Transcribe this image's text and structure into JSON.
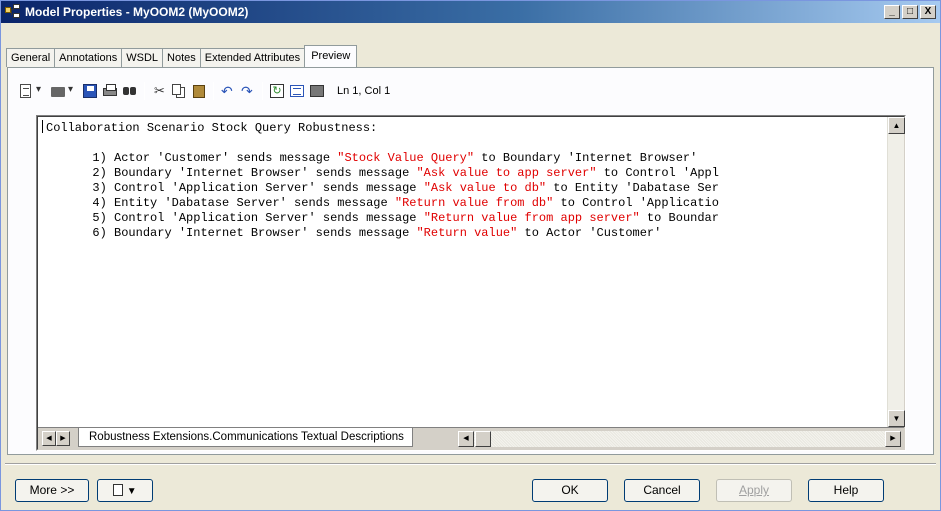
{
  "window": {
    "title": "Model Properties - MyOOM2 (MyOOM2)",
    "controls": {
      "minimize": "_",
      "maximize": "□",
      "close": "X"
    }
  },
  "tabs": [
    "General",
    "Annotations",
    "WSDL",
    "Notes",
    "Extended Attributes",
    "Preview"
  ],
  "active_tab": "Preview",
  "toolbar": {
    "icons": [
      "templates-dropdown-icon",
      "open-dropdown-icon",
      "save-icon",
      "print-icon",
      "find-icon",
      "cut-icon",
      "copy-icon",
      "paste-icon",
      "undo-icon",
      "redo-icon",
      "refresh-icon",
      "show-list-icon",
      "properties-icon"
    ],
    "cursor_position": "Ln 1, Col 1"
  },
  "editor": {
    "heading": "Collaboration Scenario Stock Query Robustness:",
    "lines": [
      {
        "num": "1)",
        "pre": " Actor 'Customer' sends message ",
        "msg": "\"Stock Value Query\"",
        "post": " to Boundary 'Internet Browser'"
      },
      {
        "num": "2)",
        "pre": " Boundary 'Internet Browser' sends message ",
        "msg": "\"Ask value to app server\"",
        "post": " to Control 'Appl"
      },
      {
        "num": "3)",
        "pre": " Control 'Application Server' sends message ",
        "msg": "\"Ask value to db\"",
        "post": " to Entity 'Dabatase Ser"
      },
      {
        "num": "4)",
        "pre": " Entity 'Dabatase Server' sends message ",
        "msg": "\"Return value from db\"",
        "post": " to Control 'Applicatio"
      },
      {
        "num": "5)",
        "pre": " Control 'Application Server' sends message ",
        "msg": "\"Return value from app server\"",
        "post": " to Boundar"
      },
      {
        "num": "6)",
        "pre": " Boundary 'Internet Browser' sends message ",
        "msg": "\"Return value\"",
        "post": " to Actor 'Customer'"
      }
    ],
    "sheet_tab": "Robustness Extensions.Communications Textual Descriptions",
    "highlight_color": "#e00000"
  },
  "buttons": {
    "more": "More >>",
    "ok": "OK",
    "cancel": "Cancel",
    "apply": "Apply",
    "help": "Help"
  }
}
